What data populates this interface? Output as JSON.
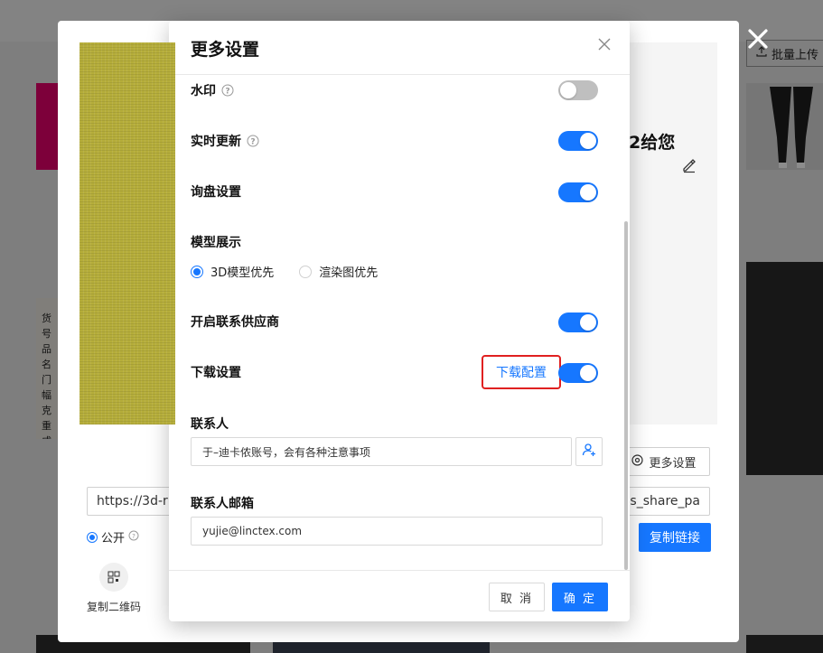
{
  "background": {
    "upload_button_label": "批量上传",
    "doc_lines": [
      "货号",
      "品名",
      "门幅",
      "克重",
      "成分"
    ]
  },
  "share_dialog": {
    "title_fragment": "2给您",
    "more_settings_label": "更多设置",
    "link_value": "https://3d-r",
    "link_tail": "is_share_pa",
    "public_label": "公开",
    "copy_link_label": "复制链接",
    "qr_label": "复制二维码"
  },
  "modal": {
    "title": "更多设置",
    "settings": {
      "watermark": {
        "label": "水印",
        "enabled": false
      },
      "realtime_update": {
        "label": "实时更新",
        "enabled": true
      },
      "inquiry": {
        "label": "询盘设置",
        "enabled": true
      },
      "model_display": {
        "label": "模型展示",
        "options": [
          "3D模型优先",
          "渲染图优先"
        ],
        "selected": "3D模型优先"
      },
      "contact_supplier": {
        "label": "开启联系供应商",
        "enabled": true
      },
      "download": {
        "label": "下载设置",
        "enabled": true,
        "config_link": "下载配置"
      }
    },
    "contact": {
      "label": "联系人",
      "value": "于–迪卡侬账号，会有各种注意事项"
    },
    "contact_email": {
      "label": "联系人邮箱",
      "value": "yujie@linctex.com"
    },
    "footer": {
      "cancel_label": "取 消",
      "ok_label": "确 定"
    }
  },
  "colors": {
    "primary": "#1677ff",
    "switch_off": "#bfbfbf",
    "highlight_border": "#e02020"
  }
}
